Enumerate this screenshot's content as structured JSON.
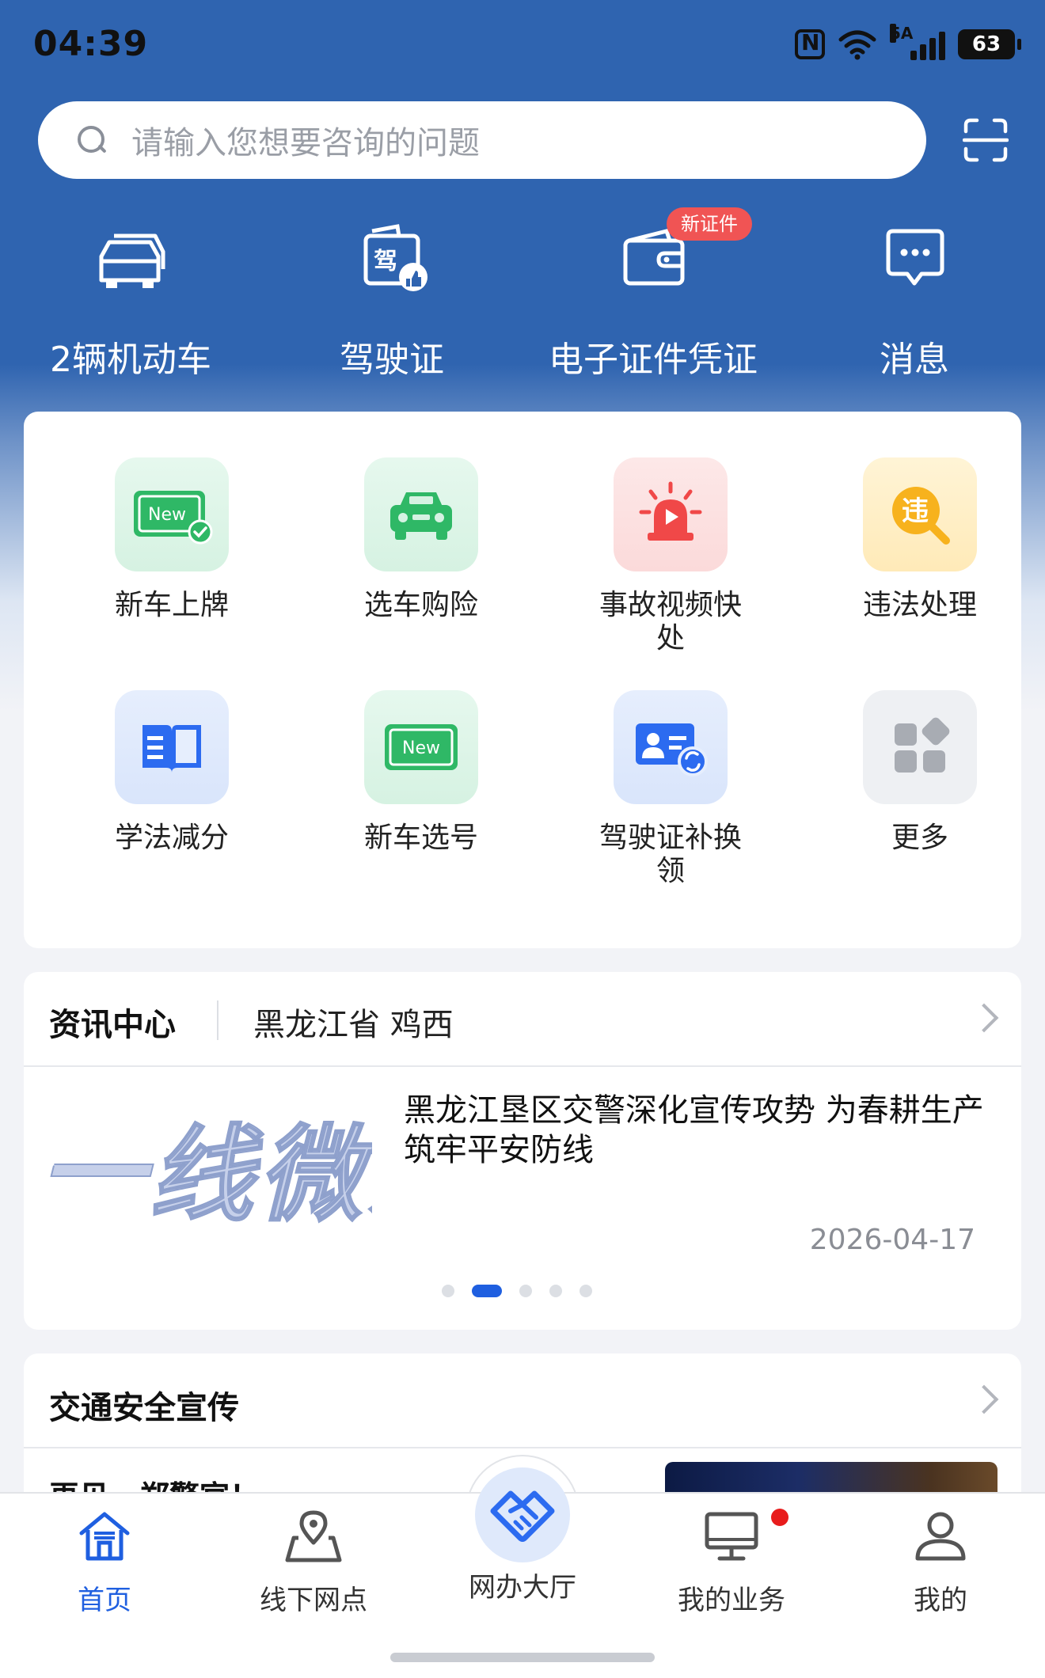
{
  "status_bar": {
    "time": "04:39",
    "network": "5A",
    "battery": "63"
  },
  "search": {
    "placeholder": "请输入您想要咨询的问题"
  },
  "quick_row": {
    "items": [
      {
        "label": "2辆机动车",
        "icon": "car-icon"
      },
      {
        "label": "驾驶证",
        "icon": "license-icon"
      },
      {
        "label": "电子证件凭证",
        "icon": "wallet-icon",
        "badge": "新证件"
      },
      {
        "label": "消息",
        "icon": "message-icon"
      }
    ]
  },
  "services": {
    "items": [
      {
        "label": "新车上牌",
        "icon": "new-plate-icon"
      },
      {
        "label": "选车购险",
        "icon": "car-insurance-icon"
      },
      {
        "label": "事故视频快处",
        "icon": "alarm-video-icon"
      },
      {
        "label": "违法处理",
        "icon": "violation-icon",
        "icon_text": "违"
      },
      {
        "label": "学法减分",
        "icon": "book-icon"
      },
      {
        "label": "新车选号",
        "icon": "plate-number-icon"
      },
      {
        "label": "驾驶证补换领",
        "icon": "license-renew-icon"
      },
      {
        "label": "更多",
        "icon": "more-grid-icon"
      }
    ]
  },
  "news": {
    "title": "资讯中心",
    "location": "黑龙江省 鸡西",
    "thumb_text": "一线微观",
    "headline": "黑龙江垦区交警深化宣传攻势 为春耕生产筑牢平安防线",
    "date": "2026-04-17",
    "carousel_total": 5,
    "carousel_active": 2
  },
  "safety": {
    "title": "交通安全宣传",
    "item_text": "再见，郑警官！"
  },
  "bottom_nav": {
    "items": [
      {
        "label": "首页",
        "icon": "home-icon",
        "active": true
      },
      {
        "label": "线下网点",
        "icon": "map-pin-icon"
      },
      {
        "label": "网办大厅",
        "icon": "handshake-icon"
      },
      {
        "label": "我的业务",
        "icon": "monitor-icon",
        "has_dot": true
      },
      {
        "label": "我的",
        "icon": "user-icon"
      }
    ]
  },
  "colors": {
    "header_blue": "#2f64b0",
    "accent_blue": "#1f5fe0",
    "badge_red": "#f05454",
    "dot_red": "#e81c1c"
  }
}
